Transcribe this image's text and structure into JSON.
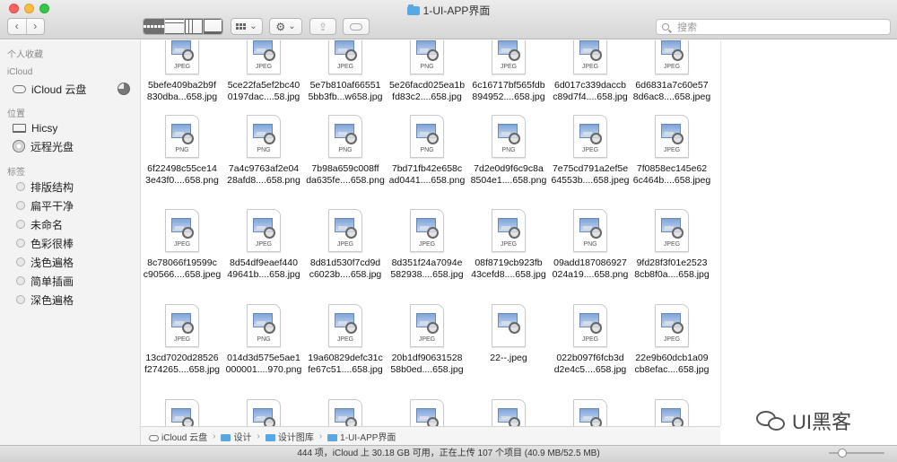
{
  "window": {
    "title": "1-UI-APP界面",
    "lights": [
      "#fc605c",
      "#fdbc40",
      "#34c84a"
    ]
  },
  "toolbar": {
    "back_glyph": "‹",
    "forward_glyph": "›",
    "arrange_caret": "⌄",
    "action_caret": "⌄",
    "gear_glyph": "⚙",
    "share_glyph": "⇪",
    "view_modes": [
      "icon-view",
      "list-view",
      "column-view",
      "cover-flow-view"
    ],
    "active_view": "icon-view"
  },
  "search": {
    "placeholder": "搜索"
  },
  "sidebar": {
    "favorites_title": "个人收藏",
    "icloud_title": "iCloud",
    "icloud_drive": "iCloud 云盘",
    "locations_title": "位置",
    "locations": [
      "Hicsy",
      "远程光盘"
    ],
    "tags_title": "标签",
    "tags": [
      "排版结构",
      "扁平干净",
      "未命名",
      "色彩很棒",
      "浅色遍格",
      "简单插画",
      "深色遍格"
    ]
  },
  "files": {
    "row0": [
      {
        "l1": "5befe409ba2b9f",
        "l2": "830dba...658.jpg",
        "ext": "JPEG"
      },
      {
        "l1": "5ce22fa5ef2bc40",
        "l2": "0197dac....58.jpg",
        "ext": "JPEG"
      },
      {
        "l1": "5e7b810af66551",
        "l2": "5bb3fb...w658.jpg",
        "ext": "JPEG"
      },
      {
        "l1": "5e26facd025ea1b",
        "l2": "fd83c2....658.jpg",
        "ext": "PNG"
      },
      {
        "l1": "6c16717bf565fdb",
        "l2": "894952....658.jpg",
        "ext": "JPEG"
      },
      {
        "l1": "6d017c339daccb",
        "l2": "c89d7f4....658.jpg",
        "ext": "JPEG"
      },
      {
        "l1": "6d6831a7c60e57",
        "l2": "8d6ac8....658.jpeg",
        "ext": "JPEG"
      }
    ],
    "row1": [
      {
        "l1": "6f22498c55ce14",
        "l2": "3e43f0....658.png",
        "ext": "PNG"
      },
      {
        "l1": "7a4c9763af2e04",
        "l2": "28afd8....658.png",
        "ext": "PNG"
      },
      {
        "l1": "7b98a659c008ff",
        "l2": "da635fe....658.png",
        "ext": "PNG"
      },
      {
        "l1": "7bd71fb42e658c",
        "l2": "ad0441....658.png",
        "ext": "PNG"
      },
      {
        "l1": "7d2e0d9f6c9c8a",
        "l2": "8504e1....658.png",
        "ext": "PNG"
      },
      {
        "l1": "7e75cd791a2ef5e",
        "l2": "64553b....658.jpeg",
        "ext": "JPEG"
      },
      {
        "l1": "7f0858ec145e62",
        "l2": "6c464b....658.jpeg",
        "ext": "JPEG"
      }
    ],
    "row2": [
      {
        "l1": "8c78066f19599c",
        "l2": "c90566....658.jpeg",
        "ext": "JPEG"
      },
      {
        "l1": "8d54df9eaef440",
        "l2": "49641b....658.jpg",
        "ext": "JPEG"
      },
      {
        "l1": "8d81d530f7cd9d",
        "l2": "c6023b....658.jpg",
        "ext": "JPEG"
      },
      {
        "l1": "8d351f24a7094e",
        "l2": "582938....658.jpg",
        "ext": "JPEG"
      },
      {
        "l1": "08f8719cb923fb",
        "l2": "43cefd8....658.jpg",
        "ext": "JPEG"
      },
      {
        "l1": "09add187086927",
        "l2": "024a19....658.png",
        "ext": "PNG"
      },
      {
        "l1": "9fd28f3f01e2523",
        "l2": "8cb8f0a....658.jpg",
        "ext": "JPEG"
      }
    ],
    "row3": [
      {
        "l1": "13cd7020d28526",
        "l2": "f274265....658.jpg",
        "ext": "JPEG"
      },
      {
        "l1": "014d3d575e5ae1",
        "l2": "000001....970.png",
        "ext": "PNG"
      },
      {
        "l1": "19a60829defc31c",
        "l2": "fe67c51....658.jpg",
        "ext": "JPEG"
      },
      {
        "l1": "20b1df90631528",
        "l2": "58b0ed....658.jpg",
        "ext": "JPEG"
      },
      {
        "l1": "22--.jpeg",
        "l2": "",
        "ext": ""
      },
      {
        "l1": "022b097f6fcb3d",
        "l2": "d2e4c5....658.jpg",
        "ext": "JPEG"
      },
      {
        "l1": "22e9b60dcb1a09",
        "l2": "cb8efac....658.jpg",
        "ext": "JPEG"
      }
    ]
  },
  "pathbar": [
    "iCloud 云盘",
    "设计",
    "设计图库",
    "1-UI-APP界面"
  ],
  "pathbar_sep": "›",
  "status": {
    "text": "444 项，iCloud 上 30.18 GB 可用，正在上传 107 个项目 (40.9 MB/52.5 MB)",
    "icon_size_slider_level": 0.2
  },
  "watermark": {
    "text": "UI黑客"
  }
}
